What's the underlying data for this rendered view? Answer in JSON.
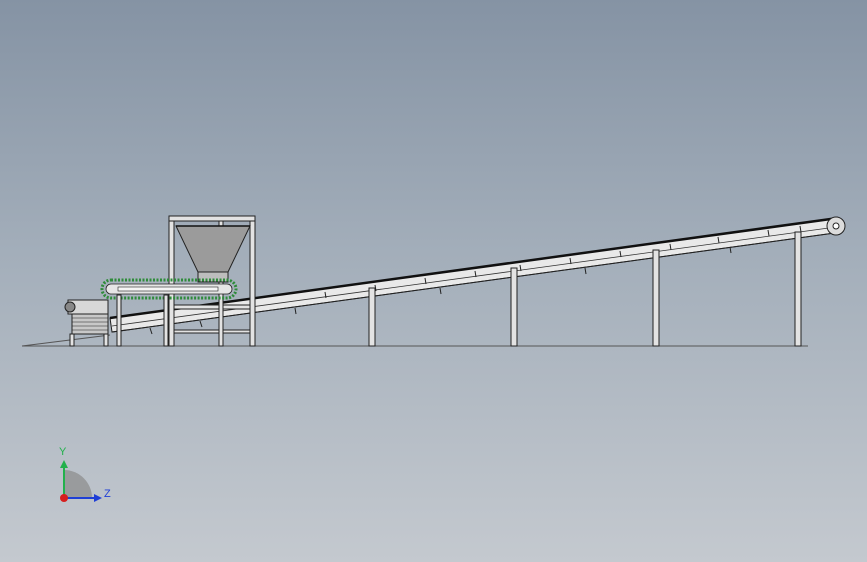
{
  "viewport": {
    "background_top": "#8593a4",
    "background_bottom": "#c4c9cf"
  },
  "model": {
    "name": "belt-conveyor-assembly",
    "line_color": "#1f1f1f",
    "frame_color": "#e6e6e6",
    "hopper_color": "#9b9b9b",
    "chain_color": "#2e8b3a"
  },
  "triad": {
    "y_label": "Y",
    "z_label": "Z",
    "y_color": "#22b14c",
    "z_color": "#1f3fd6",
    "origin_color": "#d61f1f"
  }
}
